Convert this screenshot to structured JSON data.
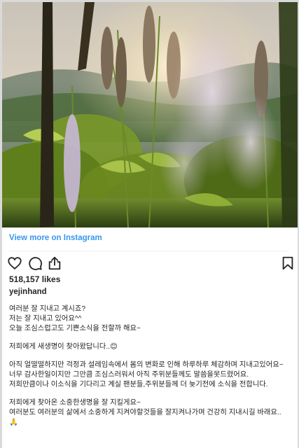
{
  "post": {
    "view_more_label": "View more on Instagram",
    "likes": "518,157 likes",
    "username": "yejinhand",
    "caption_lines_1": [
      "여러분 잘 지내고 계시죠?",
      "저는 잘 지내고 있어요^^",
      "오늘 조심스럽고도 기쁜소식을 전할까 해요~"
    ],
    "caption_lines_2": [
      "저희에게 새생명이 찾아왔답니다..😊"
    ],
    "caption_lines_3": [
      "아직 얼떨떨하지만 걱정과 설레임속에서 몸의 변화로 인해 하루하루 체감하며 지내고있어요~",
      "너무 감사한일이지만 그만큼 조심스러워서 아직 주위분들께도 말씀을못드렸어요.",
      "저희만큼이나 이소식을 기다리고 계실 팬분들,주위분들께 더 늦기전에 소식을 전합니다."
    ],
    "caption_lines_4": [
      "저희에게 찾아온 소중한생명을 잘 지킬게요~",
      "여러분도 여러분의 삶에서 소중하게 지켜야할것들을 잘지켜나가며 건강히 지내시길 바래요..",
      "🙏"
    ]
  },
  "icons": {
    "like": "heart-icon",
    "comment": "comment-bubble-icon",
    "share": "share-icon",
    "save": "bookmark-icon"
  },
  "colors": {
    "link": "#3897f0",
    "text": "#262626",
    "divider": "#efefef"
  }
}
